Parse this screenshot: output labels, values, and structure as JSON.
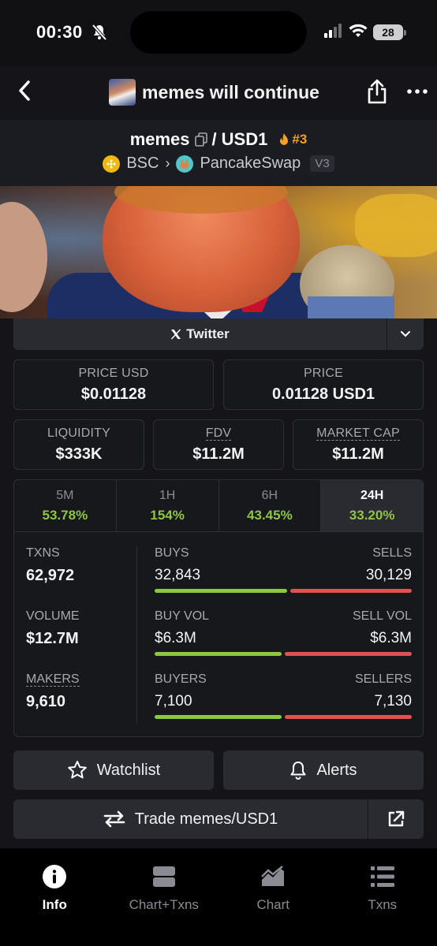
{
  "status": {
    "time": "00:30",
    "battery": "28"
  },
  "nav": {
    "title": "memes will continue"
  },
  "pair": {
    "base": "memes",
    "separator": "/",
    "quote": "USD1",
    "rank": "#3",
    "chain": "BSC",
    "dex": "PancakeSwap",
    "version": "V3"
  },
  "social": {
    "twitter_label": "Twitter"
  },
  "price": {
    "usd_label": "PRICE USD",
    "usd_value": "$0.01128",
    "quote_label": "PRICE",
    "quote_value": "0.01128 USD1"
  },
  "metrics": {
    "liquidity_label": "LIQUIDITY",
    "liquidity_value": "$333K",
    "fdv_label": "FDV",
    "fdv_value": "$11.2M",
    "mcap_label": "MARKET CAP",
    "mcap_value": "$11.2M"
  },
  "periods": [
    {
      "label": "5M",
      "change": "53.78%"
    },
    {
      "label": "1H",
      "change": "154%"
    },
    {
      "label": "6H",
      "change": "43.45%"
    },
    {
      "label": "24H",
      "change": "33.20%"
    }
  ],
  "active_period": "24H",
  "stats": {
    "txns_label": "TXNS",
    "txns_value": "62,972",
    "volume_label": "VOLUME",
    "volume_value": "$12.7M",
    "makers_label": "MAKERS",
    "makers_value": "9,610",
    "buys_label": "BUYS",
    "buys_value": "32,843",
    "sells_label": "SELLS",
    "sells_value": "30,129",
    "buyvol_label": "BUY VOL",
    "buyvol_value": "$6.3M",
    "sellvol_label": "SELL VOL",
    "sellvol_value": "$6.3M",
    "buyers_label": "BUYERS",
    "buyers_value": "7,100",
    "sellers_label": "SELLERS",
    "sellers_value": "7,130"
  },
  "ratios": {
    "buys_share": 0.522,
    "buyvol_share": 0.5,
    "buyers_share": 0.499
  },
  "actions": {
    "watchlist_label": "Watchlist",
    "alerts_label": "Alerts",
    "trade_label": "Trade memes/USD1"
  },
  "tabbar": [
    {
      "label": "Info",
      "icon": "info-icon"
    },
    {
      "label": "Chart+Txns",
      "icon": "split-view-icon"
    },
    {
      "label": "Chart",
      "icon": "chart-icon"
    },
    {
      "label": "Txns",
      "icon": "list-icon"
    }
  ],
  "colors": {
    "green": "#8dc63f",
    "red": "#e05252",
    "rank_orange": "#f2a12b",
    "background": "#151519"
  }
}
